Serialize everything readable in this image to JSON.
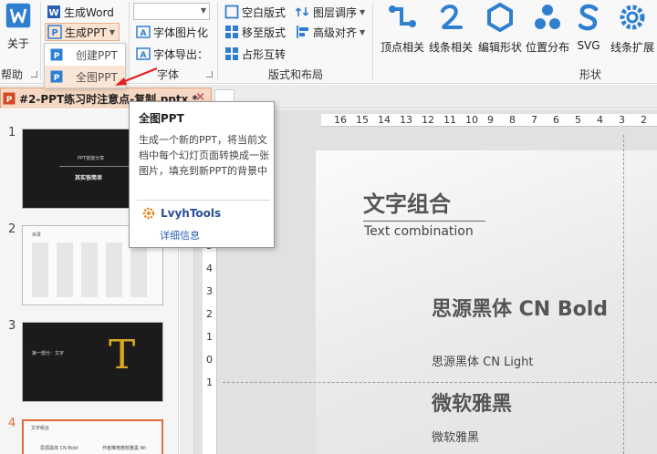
{
  "ribbon": {
    "about": {
      "label": "关于"
    },
    "help_group": "帮助",
    "generate_word": "生成Word",
    "generate_ppt": "生成PPT",
    "dropdown": {
      "create_ppt": "创建PPT",
      "full_image_ppt": "全图PPT"
    },
    "font_group": {
      "label": "字体",
      "font_to_image": "字体图片化",
      "font_export": "字体导出："
    },
    "layout_group": {
      "label": "版式和布局",
      "blank_layout": "空白版式",
      "move_to_layout": "移至版式",
      "placeholder_swap": "占形互转",
      "layer_order": "图层调序",
      "advanced_align": "高级对齐"
    },
    "shape_group": {
      "label": "形状",
      "buttons": [
        "顶点相关",
        "线条相关",
        "编辑形状",
        "位置分布",
        "SVG",
        "线条扩展"
      ]
    }
  },
  "tab": {
    "title": "#2-PPT练习时注意点-复制.pptx *",
    "close": "×"
  },
  "thumbnails": {
    "numbers": [
      "1",
      "2",
      "3",
      "4"
    ],
    "slide1_title": "PPT技能分享",
    "slide1_sub": "其实很简单",
    "slide2_title": "目录",
    "slide3_text": "第一部分：文字",
    "slide3_glyph": "T",
    "slide4_title": "文字组合",
    "slide4_a": "思源黑体 CN Bold",
    "slide4_b": "作者推荐微软雅黑 Wi"
  },
  "ruler": {
    "h_ticks": [
      "16",
      "15",
      "14",
      "13",
      "12",
      "11",
      "10",
      "9",
      "8",
      "7",
      "6",
      "5",
      "4",
      "3",
      "2",
      "1"
    ],
    "v_ticks": [
      "8",
      "7",
      "6",
      "5",
      "4",
      "3",
      "2",
      "1",
      "0",
      "1"
    ]
  },
  "slide": {
    "title": "文字组合",
    "subtitle": "Text combination",
    "heading1": "思源黑体 CN Bold",
    "text1": "思源黑体 CN Light",
    "heading2": "微软雅黑",
    "text2": "微软雅黑"
  },
  "tooltip": {
    "title": "全图PPT",
    "body": "生成一个新的PPT，将当前文档中每个幻灯页面转换成一张图片，填充到新PPT的背景中",
    "plugin": "LvyhTools",
    "link": "详细信息"
  },
  "colors": {
    "accent": "#e46a3a",
    "icon_blue": "#2f7fd0",
    "tab_bg": "#f6d7c3"
  }
}
